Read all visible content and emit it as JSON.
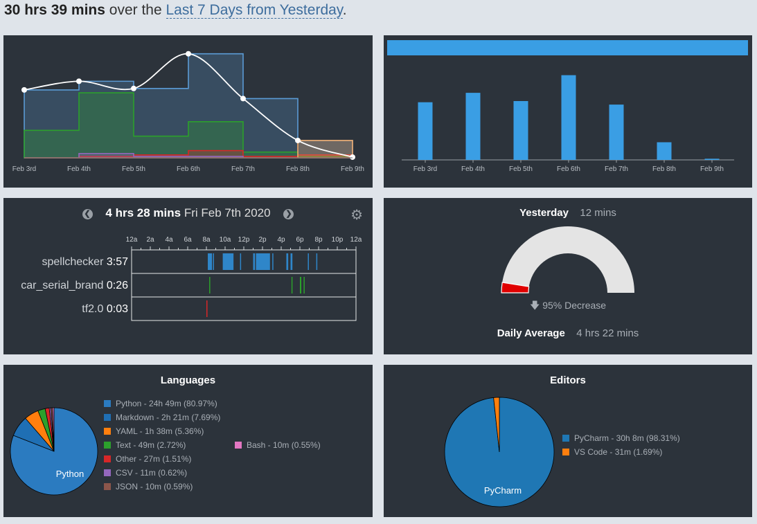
{
  "summary": {
    "total": "30 hrs 39 mins",
    "over_text": "over the",
    "range": "Last 7 Days from Yesterday",
    "period": "."
  },
  "days": [
    "Feb 3rd",
    "Feb 4th",
    "Feb 5th",
    "Feb 6th",
    "Feb 7th",
    "Feb 8th",
    "Feb 9th"
  ],
  "chart_data": [
    {
      "type": "area",
      "categories": [
        "Feb 3rd",
        "Feb 4th",
        "Feb 5th",
        "Feb 6th",
        "Feb 7th",
        "Feb 8th",
        "Feb 9th"
      ],
      "ylim": [
        0,
        8
      ],
      "total_line": [
        4.7,
        5.3,
        4.8,
        7.2,
        4.1,
        1.2,
        0.05
      ],
      "series": [
        {
          "name": "spellchecker",
          "color": "#5b9bd5",
          "values": [
            4.7,
            5.3,
            4.8,
            7.2,
            4.1,
            1.2,
            0
          ]
        },
        {
          "name": "car_serial_brand",
          "color": "#2ca02c",
          "values": [
            1.9,
            4.5,
            1.5,
            2.5,
            0.4,
            0.1,
            0
          ]
        },
        {
          "name": "tf2.0",
          "color": "#d62728",
          "values": [
            0,
            0.1,
            0.2,
            0.5,
            0.1,
            0.2,
            0
          ]
        },
        {
          "name": "",
          "color": "#9467bd",
          "values": [
            0,
            0.3,
            0.1,
            0.1,
            0,
            0,
            0
          ]
        },
        {
          "name": "",
          "color": "#f0a96a",
          "values": [
            0,
            0,
            0,
            0,
            0,
            1.2,
            0.1
          ]
        }
      ]
    },
    {
      "type": "bar",
      "categories": [
        "Feb 3rd",
        "Feb 4th",
        "Feb 5th",
        "Feb 6th",
        "Feb 7th",
        "Feb 8th",
        "Feb 9th"
      ],
      "values": [
        4.9,
        5.7,
        5.0,
        7.2,
        4.7,
        1.5,
        0.1
      ],
      "ylim": [
        0,
        8
      ],
      "color": "#3a9ee4"
    },
    {
      "type": "pie",
      "title": "Languages",
      "slices": [
        {
          "label": "Python - 24h 49m (80.97%)",
          "value": 80.97,
          "color": "#2b7bc0"
        },
        {
          "label": "Markdown - 2h 21m (7.69%)",
          "value": 7.69,
          "color": "#1f6fb4"
        },
        {
          "label": "YAML - 1h 38m (5.36%)",
          "value": 5.36,
          "color": "#ff7f0e"
        },
        {
          "label": "Text - 49m (2.72%)",
          "value": 2.72,
          "color": "#2ca02c"
        },
        {
          "label": "Other - 27m (1.51%)",
          "value": 1.51,
          "color": "#d62728"
        },
        {
          "label": "CSV - 11m (0.62%)",
          "value": 0.62,
          "color": "#9467bd"
        },
        {
          "label": "JSON - 10m (0.59%)",
          "value": 0.59,
          "color": "#8c564b"
        },
        {
          "label": "Bash - 10m (0.55%)",
          "value": 0.55,
          "color": "#e377c2"
        }
      ],
      "center_label": "Python"
    },
    {
      "type": "pie",
      "title": "Editors",
      "slices": [
        {
          "label": "PyCharm - 30h 8m (98.31%)",
          "value": 98.31,
          "color": "#1f77b4"
        },
        {
          "label": "VS Code - 31m (1.69%)",
          "value": 1.69,
          "color": "#ff7f0e"
        }
      ],
      "center_label": "PyCharm"
    }
  ],
  "day_view": {
    "duration": "4 hrs 28 mins",
    "date": "Fri Feb 7th 2020",
    "prev_icon": "chevron-left-icon",
    "next_icon": "chevron-right-icon",
    "settings_icon": "gear-icon",
    "hours": [
      "12a",
      "2a",
      "4a",
      "6a",
      "8a",
      "10a",
      "12p",
      "2p",
      "4p",
      "6p",
      "8p",
      "10p",
      "12a"
    ],
    "projects": [
      {
        "name": "spellchecker",
        "time": "3:57",
        "color": "#2f86c9",
        "spans": [
          [
            8.15,
            8.6
          ],
          [
            8.7,
            8.8
          ],
          [
            9.75,
            10.9
          ],
          [
            11.6,
            11.7
          ],
          [
            13.0,
            13.2
          ],
          [
            13.3,
            14.8
          ],
          [
            15.05,
            15.15
          ],
          [
            16.55,
            16.75
          ],
          [
            17.0,
            17.2
          ],
          [
            18.85,
            18.95
          ],
          [
            19.75,
            19.85
          ]
        ]
      },
      {
        "name": "car_serial_brand",
        "time": "0:26",
        "color": "#2ca02c",
        "spans": [
          [
            8.3,
            8.35
          ],
          [
            17.1,
            17.2
          ],
          [
            18.0,
            18.15
          ],
          [
            18.4,
            18.5
          ]
        ]
      },
      {
        "name": "tf2.0",
        "time": "0:03",
        "color": "#d62728",
        "spans": [
          [
            8.0,
            8.1
          ]
        ]
      }
    ]
  },
  "gauge": {
    "label": "Yesterday",
    "value": "12 mins",
    "change": "95% Decrease",
    "change_icon": "arrow-down-icon",
    "fraction": 0.05,
    "avg_label": "Daily Average",
    "avg_value": "4 hrs 22 mins"
  }
}
